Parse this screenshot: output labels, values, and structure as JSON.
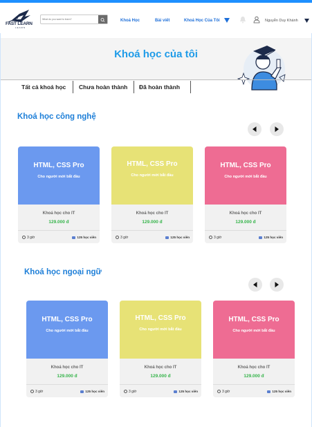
{
  "header": {
    "logo_text": "FAST LEARN",
    "logo_sub": "LEARN",
    "search_placeholder": "What do you want to learn?",
    "nav": [
      {
        "label": "Khoá Học"
      },
      {
        "label": "Bài viết"
      },
      {
        "label": "Khoá Học Của Tôi"
      }
    ],
    "user_name": "Nguyễn Duy Khánh",
    "colors": {
      "accent": "#1e90ff",
      "nav": "#1e6fd9"
    }
  },
  "banner": {
    "title": "Khoá học của tôi"
  },
  "tabs": [
    {
      "label": "Tất cả khoá học"
    },
    {
      "label": "Chưa hoàn thành"
    },
    {
      "label": "Đã hoàn thành"
    }
  ],
  "sections": [
    {
      "title": "Khoá học công nghệ",
      "courses": [
        {
          "title": "HTML, CSS Pro",
          "subtitle": "Cho người mới bắt đầu",
          "category": "Khoá học cho IT",
          "price": "129.000 đ",
          "hours": "3 giờ",
          "students": "125 học viên",
          "color": "#6b99ef"
        },
        {
          "title": "HTML, CSS Pro",
          "subtitle": "Cho người mới bắt đầu",
          "category": "Khoá học cho IT",
          "price": "129.000 đ",
          "hours": "3 giờ",
          "students": "125 học viên",
          "color": "#e7e276"
        },
        {
          "title": "HTML, CSS Pro",
          "subtitle": "Cho người mới bắt đầu",
          "category": "Khoá học cho IT",
          "price": "129.000 đ",
          "hours": "3 giờ",
          "students": "125 học viên",
          "color": "#ee6c93"
        }
      ]
    },
    {
      "title": "Khoá học ngoại ngữ",
      "courses": [
        {
          "title": "HTML, CSS Pro",
          "subtitle": "Cho người mới bắt đầu",
          "category": "Khoá học cho IT",
          "price": "129.000 đ",
          "hours": "3 giờ",
          "students": "125 học viên",
          "color": "#6b99ef"
        },
        {
          "title": "HTML, CSS Pro",
          "subtitle": "Cho người mới bắt đầu",
          "category": "Khoá học cho IT",
          "price": "129.000 đ",
          "hours": "3 giờ",
          "students": "125 học viên",
          "color": "#e7e276"
        },
        {
          "title": "HTML, CSS Pro",
          "subtitle": "Cho người mới bắt đầu",
          "category": "Khoá học cho IT",
          "price": "129.000 đ",
          "hours": "3 giờ",
          "students": "125 học viên",
          "color": "#ee6c93"
        }
      ]
    }
  ],
  "icons": {
    "prev": "arrow-left-icon",
    "next": "arrow-right-icon",
    "clock": "clock-icon",
    "students": "people-icon",
    "bell": "bell-icon",
    "user": "user-icon"
  }
}
